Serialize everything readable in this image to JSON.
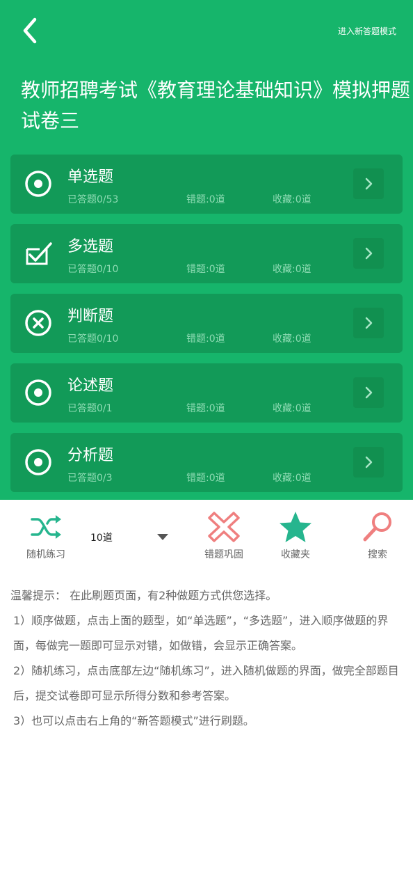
{
  "header": {
    "back_icon": "chevron-left-icon",
    "new_mode_label": "进入新答题模式",
    "title": "教师招聘考试《教育理论基础知识》模拟押题试卷三"
  },
  "categories": [
    {
      "icon": "radio-target-icon",
      "name": "单选题",
      "answered": "已答题0/53",
      "wrong": "错题:0道",
      "favorites": "收藏:0道"
    },
    {
      "icon": "checkbox-check-icon",
      "name": "多选题",
      "answered": "已答题0/10",
      "wrong": "错题:0道",
      "favorites": "收藏:0道"
    },
    {
      "icon": "circle-x-icon",
      "name": "判断题",
      "answered": "已答题0/10",
      "wrong": "错题:0道",
      "favorites": "收藏:0道"
    },
    {
      "icon": "radio-target-icon",
      "name": "论述题",
      "answered": "已答题0/1",
      "wrong": "错题:0道",
      "favorites": "收藏:0道"
    },
    {
      "icon": "radio-target-icon",
      "name": "分析题",
      "answered": "已答题0/3",
      "wrong": "错题:0道",
      "favorites": "收藏:0道"
    }
  ],
  "toolbar": {
    "random_label": "随机练习",
    "count_value": "10道",
    "wrong_review_label": "错题巩固",
    "favorites_label": "收藏夹",
    "search_label": "搜索"
  },
  "tips": {
    "intro": "温馨提示： 在此刷题页面，有2种做题方式供您选择。",
    "item1": "1）顺序做题，点击上面的题型，如“单选题”，“多选题”，进入顺序做题的界面，每做完一题即可显示对错，如做错，会显示正确答案。",
    "item2": "2）随机练习，点击底部左边“随机练习”，进入随机做题的界面，做完全部题目后，提交试卷即可显示所得分数和参考答案。",
    "item3": "3）也可以点击右上角的“新答题模式”进行刷题。"
  },
  "colors": {
    "brand_green": "#16b56b",
    "card_green": "#129a58",
    "accent_teal": "#26b58e",
    "danger_pink": "#ef7f7f"
  }
}
